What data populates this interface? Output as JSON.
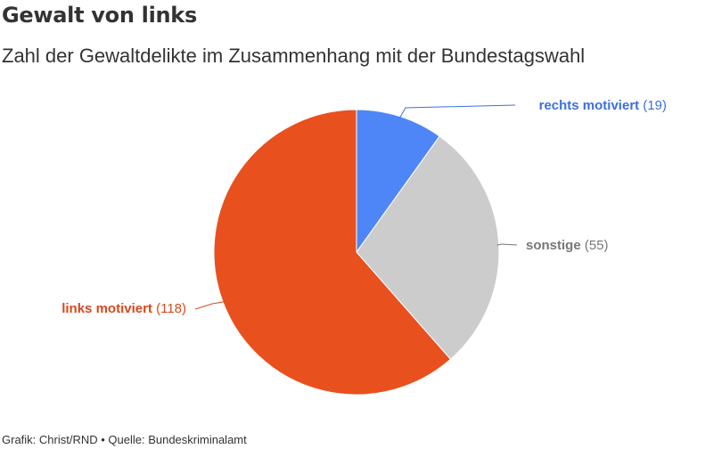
{
  "header": {
    "title": "Gewalt von links",
    "subtitle": "Zahl der Gewaltdelikte im Zusammenhang mit der Bundestagswahl"
  },
  "chart_data": {
    "type": "pie",
    "title": "Gewalt von links",
    "subtitle": "Zahl der Gewaltdelikte im Zusammenhang mit der Bundestagswahl",
    "start_angle_deg": 0,
    "direction": "clockwise",
    "slices": [
      {
        "label": "rechts motiviert",
        "value": 19,
        "value_text": "(19)",
        "color": "#4f86f7",
        "label_color": "#3b6fe0"
      },
      {
        "label": "sonstige",
        "value": 55,
        "value_text": "(55)",
        "color": "#cccccc",
        "label_color": "#777777"
      },
      {
        "label": "links motiviert",
        "value": 118,
        "value_text": "(118)",
        "color": "#e8501e",
        "label_color": "#d9481c"
      }
    ]
  },
  "footer": {
    "credit": "Grafik: Christ/RND • Quelle: Bundeskriminalamt"
  }
}
